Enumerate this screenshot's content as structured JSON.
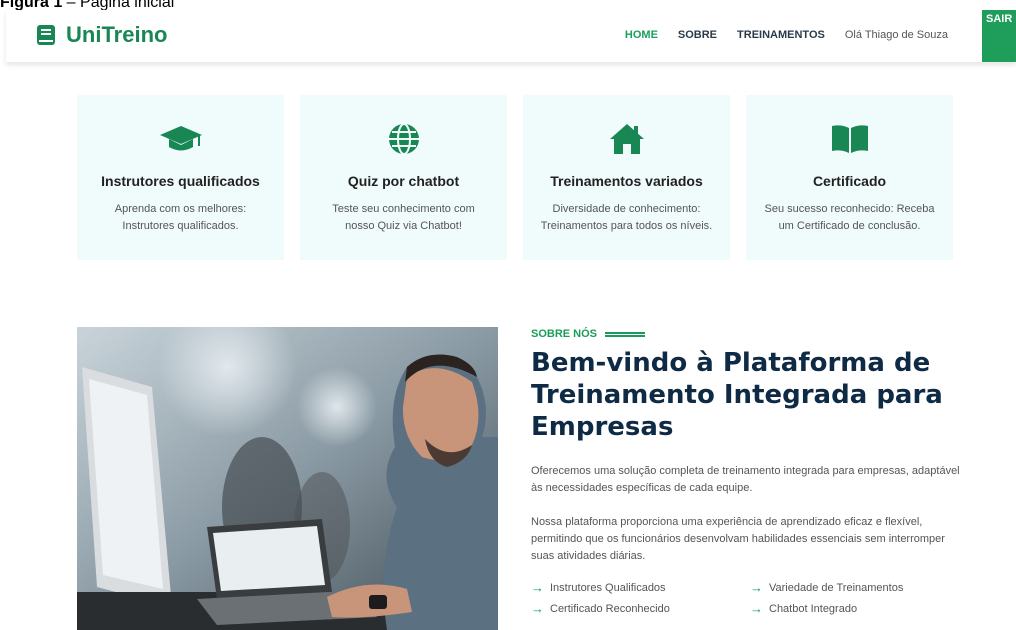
{
  "caption": {
    "prefix": "Figura 1",
    "text": " – Página inicial"
  },
  "brand": {
    "name": "UniTreino",
    "icon": "book-icon",
    "color": "#198754"
  },
  "nav": {
    "home": "HOME",
    "sobre": "SOBRE",
    "treinamentos": "TREINAMENTOS",
    "greeting": "Olá Thiago de Souza",
    "logout": "SAIR"
  },
  "features": [
    {
      "icon": "graduation-cap-icon",
      "title": "Instrutores qualificados",
      "line1": "Aprenda com os melhores:",
      "line2": "Instrutores qualificados."
    },
    {
      "icon": "globe-icon",
      "title": "Quiz por chatbot",
      "line1": "Teste seu conhecimento com",
      "line2": "nosso Quiz via Chatbot!"
    },
    {
      "icon": "home-icon",
      "title": "Treinamentos variados",
      "line1": "Diversidade de conhecimento:",
      "line2": "Treinamentos para todos os níveis."
    },
    {
      "icon": "open-book-icon",
      "title": "Certificado",
      "line1": "Seu sucesso reconhecido: Receba",
      "line2": "um Certificado de conclusão."
    }
  ],
  "about": {
    "kicker": "SOBRE NÓS",
    "title": "Bem-vindo à Plataforma de Treinamento Integrada para Empresas",
    "paragraph1": "Oferecemos uma solução completa de treinamento integrada para empresas, adaptável às necessidades específicas de cada equipe.",
    "paragraph2": "Nossa plataforma proporciona uma experiência de aprendizado eficaz e flexível, permitindo que os funcionários desenvolvam habilidades essenciais sem interromper suas atividades diárias.",
    "items": [
      "Instrutores Qualificados",
      "Variedade de Treinamentos",
      "Certificado Reconhecido",
      "Chatbot Integrado"
    ]
  },
  "colors": {
    "accent": "#1a9c58",
    "card_bg": "#f0fbfb",
    "title": "#0f2a44"
  }
}
